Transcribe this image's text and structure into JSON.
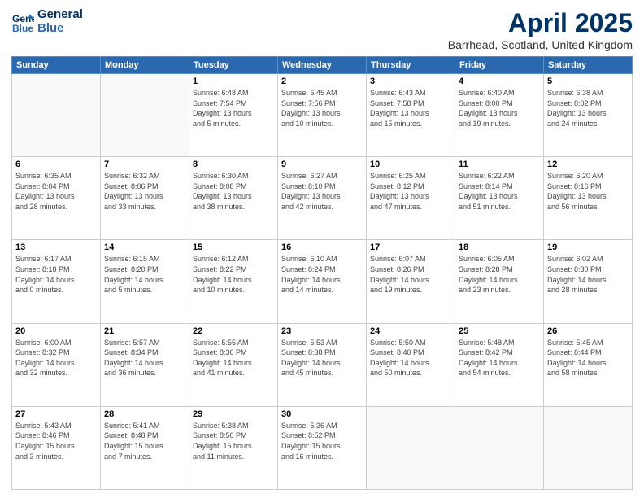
{
  "header": {
    "logo_line1": "General",
    "logo_line2": "Blue",
    "title": "April 2025",
    "subtitle": "Barrhead, Scotland, United Kingdom"
  },
  "days_of_week": [
    "Sunday",
    "Monday",
    "Tuesday",
    "Wednesday",
    "Thursday",
    "Friday",
    "Saturday"
  ],
  "weeks": [
    [
      {
        "day": "",
        "info": ""
      },
      {
        "day": "",
        "info": ""
      },
      {
        "day": "1",
        "info": "Sunrise: 6:48 AM\nSunset: 7:54 PM\nDaylight: 13 hours\nand 5 minutes."
      },
      {
        "day": "2",
        "info": "Sunrise: 6:45 AM\nSunset: 7:56 PM\nDaylight: 13 hours\nand 10 minutes."
      },
      {
        "day": "3",
        "info": "Sunrise: 6:43 AM\nSunset: 7:58 PM\nDaylight: 13 hours\nand 15 minutes."
      },
      {
        "day": "4",
        "info": "Sunrise: 6:40 AM\nSunset: 8:00 PM\nDaylight: 13 hours\nand 19 minutes."
      },
      {
        "day": "5",
        "info": "Sunrise: 6:38 AM\nSunset: 8:02 PM\nDaylight: 13 hours\nand 24 minutes."
      }
    ],
    [
      {
        "day": "6",
        "info": "Sunrise: 6:35 AM\nSunset: 8:04 PM\nDaylight: 13 hours\nand 28 minutes."
      },
      {
        "day": "7",
        "info": "Sunrise: 6:32 AM\nSunset: 8:06 PM\nDaylight: 13 hours\nand 33 minutes."
      },
      {
        "day": "8",
        "info": "Sunrise: 6:30 AM\nSunset: 8:08 PM\nDaylight: 13 hours\nand 38 minutes."
      },
      {
        "day": "9",
        "info": "Sunrise: 6:27 AM\nSunset: 8:10 PM\nDaylight: 13 hours\nand 42 minutes."
      },
      {
        "day": "10",
        "info": "Sunrise: 6:25 AM\nSunset: 8:12 PM\nDaylight: 13 hours\nand 47 minutes."
      },
      {
        "day": "11",
        "info": "Sunrise: 6:22 AM\nSunset: 8:14 PM\nDaylight: 13 hours\nand 51 minutes."
      },
      {
        "day": "12",
        "info": "Sunrise: 6:20 AM\nSunset: 8:16 PM\nDaylight: 13 hours\nand 56 minutes."
      }
    ],
    [
      {
        "day": "13",
        "info": "Sunrise: 6:17 AM\nSunset: 8:18 PM\nDaylight: 14 hours\nand 0 minutes."
      },
      {
        "day": "14",
        "info": "Sunrise: 6:15 AM\nSunset: 8:20 PM\nDaylight: 14 hours\nand 5 minutes."
      },
      {
        "day": "15",
        "info": "Sunrise: 6:12 AM\nSunset: 8:22 PM\nDaylight: 14 hours\nand 10 minutes."
      },
      {
        "day": "16",
        "info": "Sunrise: 6:10 AM\nSunset: 8:24 PM\nDaylight: 14 hours\nand 14 minutes."
      },
      {
        "day": "17",
        "info": "Sunrise: 6:07 AM\nSunset: 8:26 PM\nDaylight: 14 hours\nand 19 minutes."
      },
      {
        "day": "18",
        "info": "Sunrise: 6:05 AM\nSunset: 8:28 PM\nDaylight: 14 hours\nand 23 minutes."
      },
      {
        "day": "19",
        "info": "Sunrise: 6:02 AM\nSunset: 8:30 PM\nDaylight: 14 hours\nand 28 minutes."
      }
    ],
    [
      {
        "day": "20",
        "info": "Sunrise: 6:00 AM\nSunset: 8:32 PM\nDaylight: 14 hours\nand 32 minutes."
      },
      {
        "day": "21",
        "info": "Sunrise: 5:57 AM\nSunset: 8:34 PM\nDaylight: 14 hours\nand 36 minutes."
      },
      {
        "day": "22",
        "info": "Sunrise: 5:55 AM\nSunset: 8:36 PM\nDaylight: 14 hours\nand 41 minutes."
      },
      {
        "day": "23",
        "info": "Sunrise: 5:53 AM\nSunset: 8:38 PM\nDaylight: 14 hours\nand 45 minutes."
      },
      {
        "day": "24",
        "info": "Sunrise: 5:50 AM\nSunset: 8:40 PM\nDaylight: 14 hours\nand 50 minutes."
      },
      {
        "day": "25",
        "info": "Sunrise: 5:48 AM\nSunset: 8:42 PM\nDaylight: 14 hours\nand 54 minutes."
      },
      {
        "day": "26",
        "info": "Sunrise: 5:45 AM\nSunset: 8:44 PM\nDaylight: 14 hours\nand 58 minutes."
      }
    ],
    [
      {
        "day": "27",
        "info": "Sunrise: 5:43 AM\nSunset: 8:46 PM\nDaylight: 15 hours\nand 3 minutes."
      },
      {
        "day": "28",
        "info": "Sunrise: 5:41 AM\nSunset: 8:48 PM\nDaylight: 15 hours\nand 7 minutes."
      },
      {
        "day": "29",
        "info": "Sunrise: 5:38 AM\nSunset: 8:50 PM\nDaylight: 15 hours\nand 11 minutes."
      },
      {
        "day": "30",
        "info": "Sunrise: 5:36 AM\nSunset: 8:52 PM\nDaylight: 15 hours\nand 16 minutes."
      },
      {
        "day": "",
        "info": ""
      },
      {
        "day": "",
        "info": ""
      },
      {
        "day": "",
        "info": ""
      }
    ]
  ]
}
